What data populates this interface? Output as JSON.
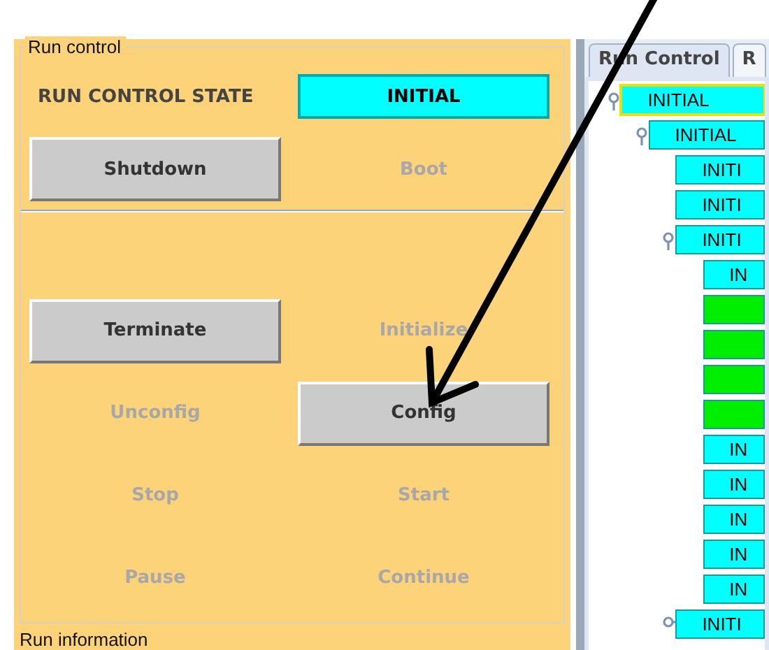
{
  "run_control": {
    "title": "Run control",
    "state_label": "RUN CONTROL STATE",
    "state_value": "INITIAL",
    "top_buttons": [
      {
        "label": "Shutdown",
        "disabled": false
      },
      {
        "label": "Boot",
        "disabled": true
      }
    ],
    "buttons": [
      {
        "label": "Terminate",
        "disabled": false
      },
      {
        "label": "Initialize",
        "disabled": true
      },
      {
        "label": "Unconfig",
        "disabled": true
      },
      {
        "label": "Config",
        "disabled": false
      },
      {
        "label": "Stop",
        "disabled": true
      },
      {
        "label": "Start",
        "disabled": true
      },
      {
        "label": "Pause",
        "disabled": true
      },
      {
        "label": "Continue",
        "disabled": true
      }
    ]
  },
  "run_information": {
    "title": "Run information"
  },
  "tabs": [
    {
      "label": "Run Control",
      "selected": true
    },
    {
      "label": "R",
      "selected": false
    }
  ],
  "tree": [
    {
      "label": "INITIAL",
      "color": "#00ffff",
      "selected": true,
      "expanded": true,
      "children": [
        {
          "label": "INITIAL",
          "color": "#00ffff",
          "selected": false,
          "expanded": true,
          "children": [
            {
              "label": "INITI",
              "color": "#00ffff",
              "selected": false
            },
            {
              "label": "INITI",
              "color": "#00ffff",
              "selected": false
            },
            {
              "label": "INITI",
              "color": "#00ffff",
              "selected": false,
              "expanded": true,
              "children": [
                {
                  "label": "IN",
                  "color": "#00ffff",
                  "selected": false
                },
                {
                  "color": "#00ee00",
                  "selected": false
                },
                {
                  "color": "#00ee00",
                  "selected": false
                },
                {
                  "color": "#00ee00",
                  "selected": false
                },
                {
                  "color": "#00ee00",
                  "selected": false
                },
                {
                  "label": "IN",
                  "color": "#00ffff",
                  "selected": false
                },
                {
                  "label": "IN",
                  "color": "#00ffff",
                  "selected": false
                },
                {
                  "label": "IN",
                  "color": "#00ffff",
                  "selected": false
                },
                {
                  "label": "IN",
                  "color": "#00ffff",
                  "selected": false
                },
                {
                  "label": "IN",
                  "color": "#00ffff",
                  "selected": false
                }
              ]
            },
            {
              "label": "INITI",
              "color": "#00ffff",
              "selected": false,
              "expanded": false
            }
          ]
        }
      ]
    }
  ]
}
